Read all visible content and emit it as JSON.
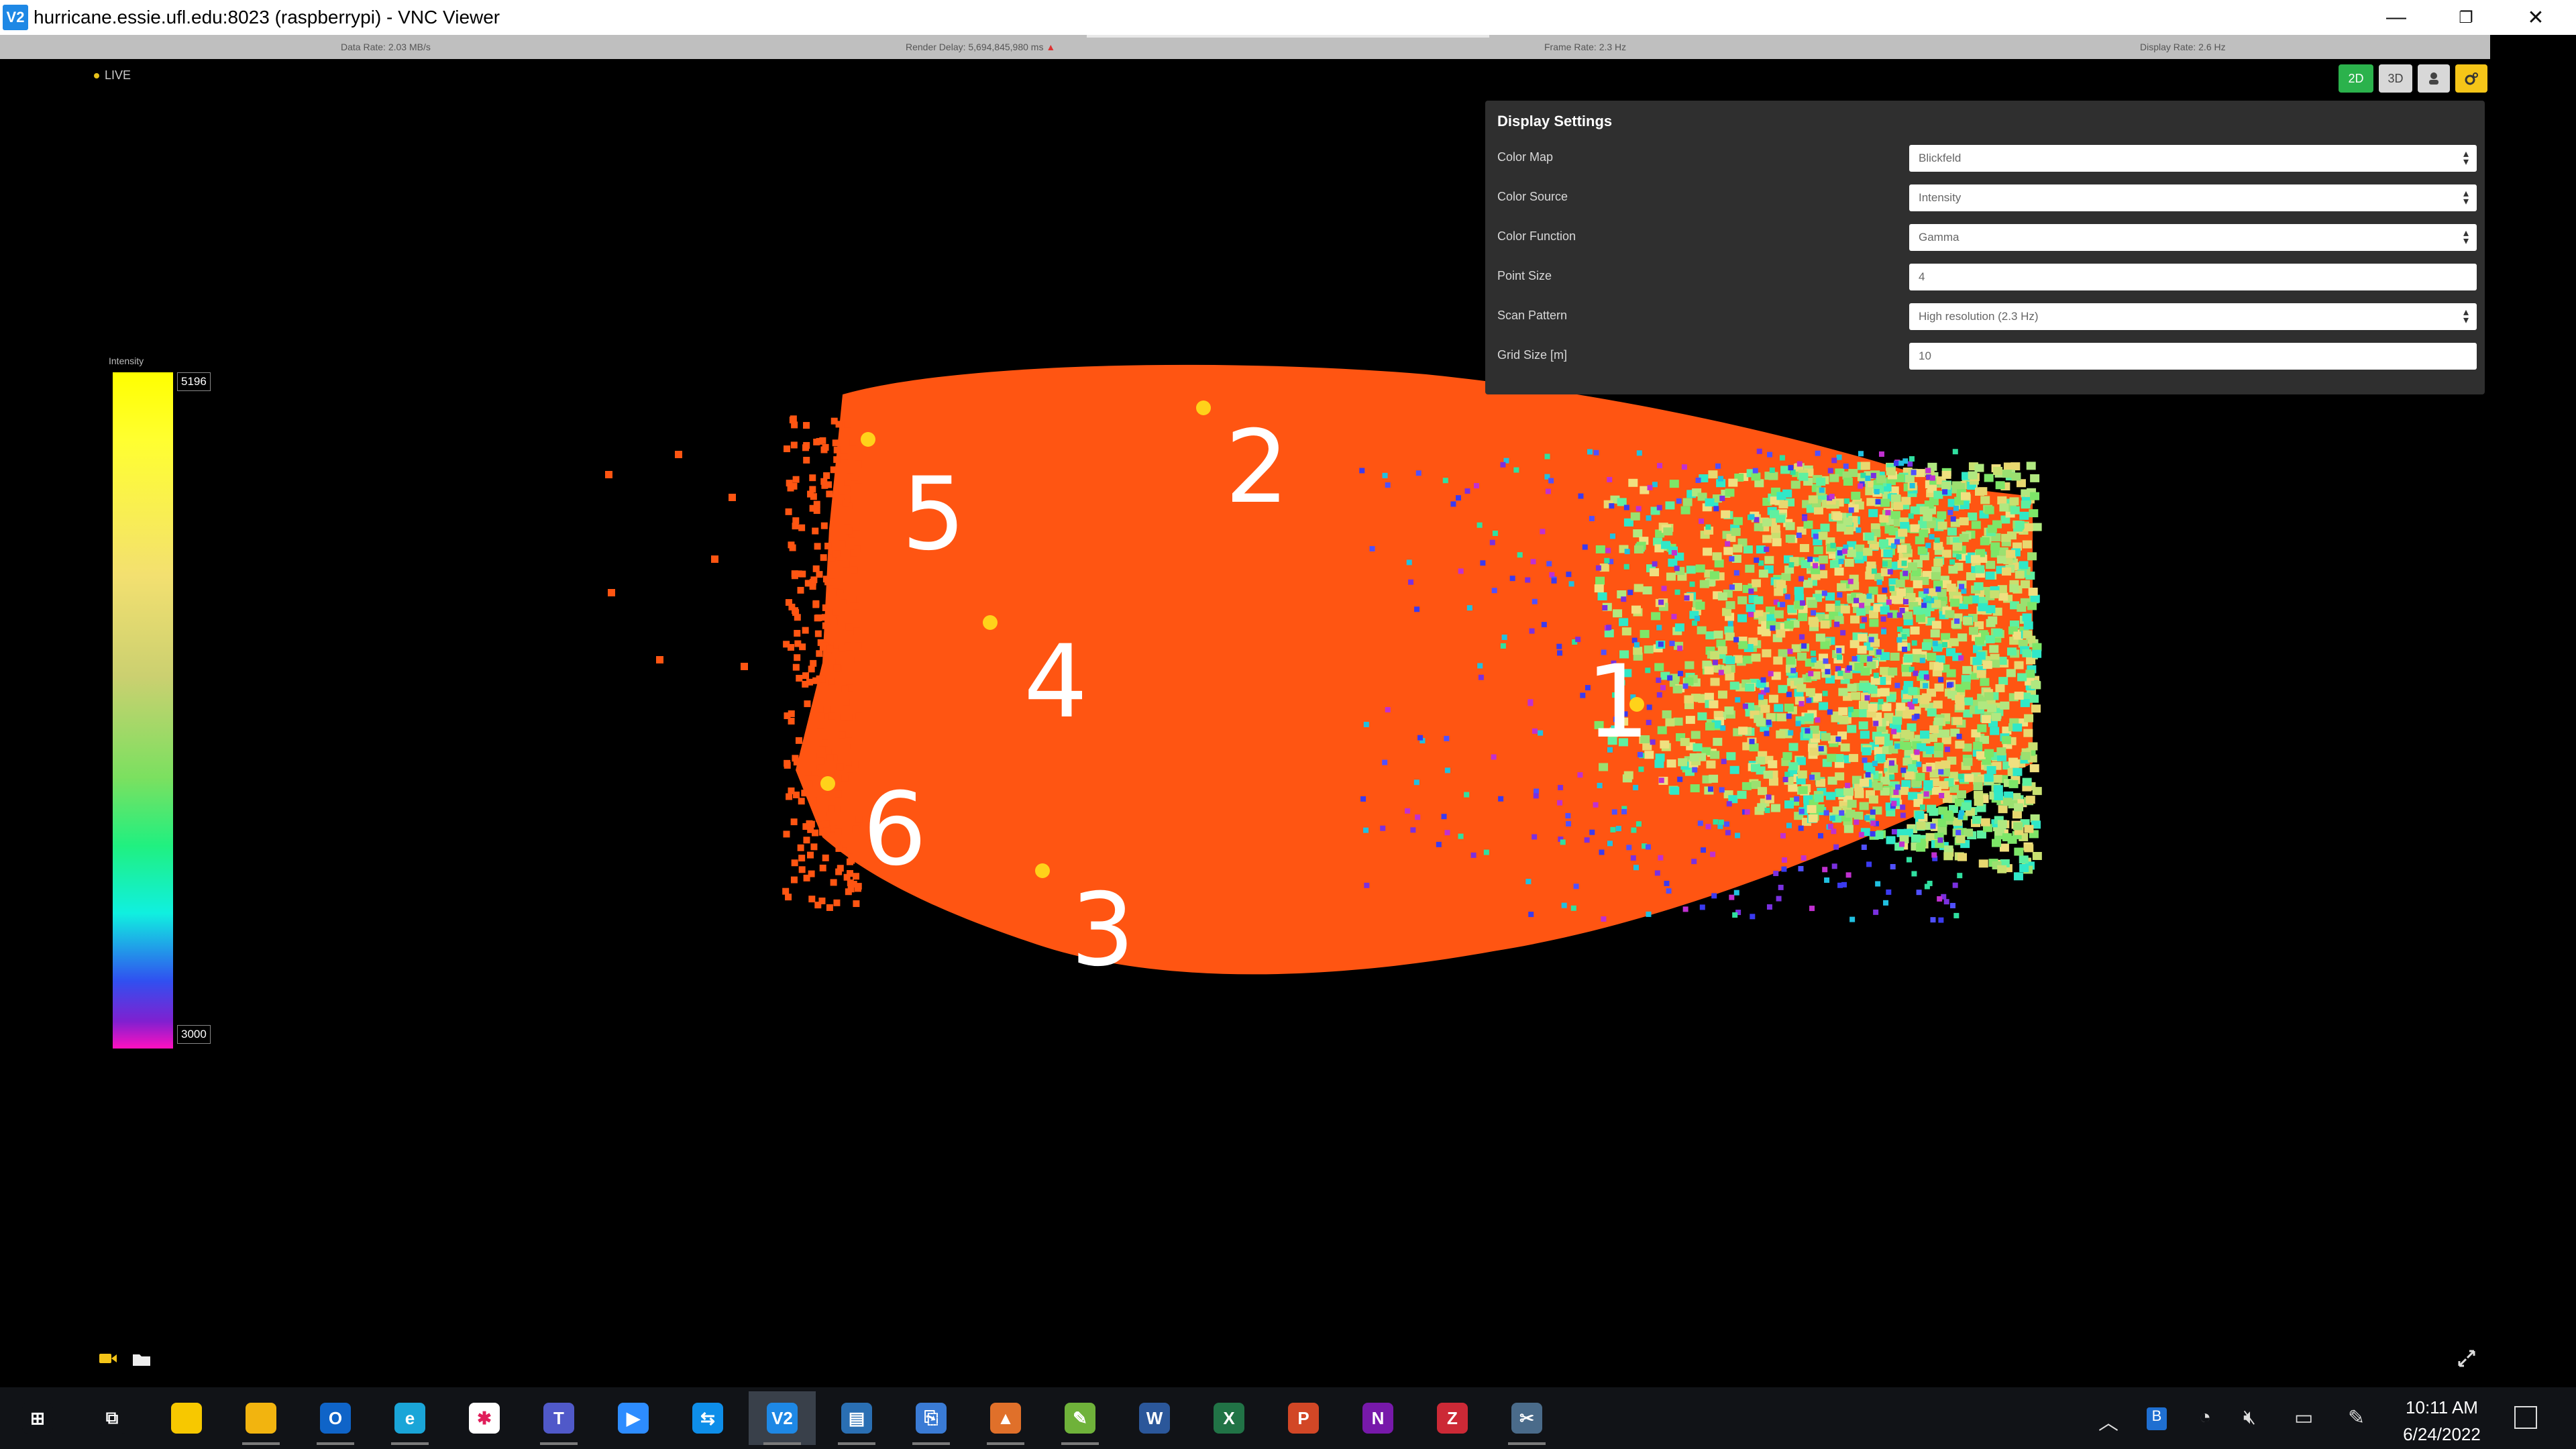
{
  "window": {
    "icon_label": "V2",
    "title": "hurricane.essie.ufl.edu:8023 (raspberrypi) - VNC Viewer",
    "minimize": "—",
    "restore": "❐",
    "close": "✕"
  },
  "stats": {
    "data_rate": "Data Rate: 2.03 MB/s",
    "render_delay": "Render Delay: 5,694,845,980 ms",
    "frame_rate": "Frame Rate: 2.3 Hz",
    "display_rate": "Display Rate: 2.6 Hz"
  },
  "viewer": {
    "live_label": "LIVE",
    "mode_buttons": [
      {
        "label": "2D",
        "active": true
      },
      {
        "label": "3D",
        "active": false
      },
      {
        "label": "",
        "icon": "person-icon"
      },
      {
        "label": "",
        "icon": "settings-gear-icon"
      }
    ]
  },
  "display_settings": {
    "title": "Display Settings",
    "rows": [
      {
        "label": "Color Map",
        "value": "Blickfeld",
        "type": "select"
      },
      {
        "label": "Color Source",
        "value": "Intensity",
        "type": "select"
      },
      {
        "label": "Color Function",
        "value": "Gamma",
        "type": "select"
      },
      {
        "label": "Point Size",
        "value": "4",
        "type": "input"
      },
      {
        "label": "Scan Pattern",
        "value": "High resolution (2.3 Hz)",
        "type": "select"
      },
      {
        "label": "Grid Size [m]",
        "value": "10",
        "type": "input"
      }
    ]
  },
  "colorbar": {
    "title": "Intensity",
    "max": "5196",
    "min": "3000"
  },
  "annotations": [
    "1",
    "2",
    "3",
    "4",
    "5",
    "6"
  ],
  "colors": {
    "cloud_orange": "#ff5512",
    "accent_green": "#2bb24c",
    "accent_yellow": "#f5c518",
    "panel_bg": "#2f2f2f"
  },
  "taskbar": {
    "apps": [
      {
        "name": "start",
        "glyph": "⊞",
        "color": "#111317"
      },
      {
        "name": "task-view",
        "glyph": "⧉",
        "color": "#111317"
      },
      {
        "name": "sticky-notes",
        "glyph": "",
        "color": "#f7c800"
      },
      {
        "name": "file-explorer",
        "glyph": "",
        "color": "#f2b40f"
      },
      {
        "name": "outlook",
        "glyph": "O",
        "color": "#0f64c8"
      },
      {
        "name": "edge",
        "glyph": "e",
        "color": "#1aa5d8"
      },
      {
        "name": "slack",
        "glyph": "✱",
        "color": "#ffffff"
      },
      {
        "name": "teams",
        "glyph": "T",
        "color": "#5059c9"
      },
      {
        "name": "zoom",
        "glyph": "▶",
        "color": "#2d8cff"
      },
      {
        "name": "teamviewer",
        "glyph": "⇆",
        "color": "#0e8ee9"
      },
      {
        "name": "vnc-viewer",
        "glyph": "V2",
        "color": "#1e88e5"
      },
      {
        "name": "clipboard",
        "glyph": "▤",
        "color": "#2a6fb3"
      },
      {
        "name": "network",
        "glyph": "⎘",
        "color": "#3a7bd5"
      },
      {
        "name": "matlab",
        "glyph": "▲",
        "color": "#e0702a"
      },
      {
        "name": "image-editor",
        "glyph": "✎",
        "color": "#6fb23a"
      },
      {
        "name": "word",
        "glyph": "W",
        "color": "#2b579a"
      },
      {
        "name": "excel",
        "glyph": "X",
        "color": "#217346"
      },
      {
        "name": "powerpoint",
        "glyph": "P",
        "color": "#d24726"
      },
      {
        "name": "onenote",
        "glyph": "N",
        "color": "#7719aa"
      },
      {
        "name": "zotero",
        "glyph": "Z",
        "color": "#cc2936"
      },
      {
        "name": "snipping",
        "glyph": "✂",
        "color": "#4a6b8a"
      }
    ],
    "time": "10:11 AM",
    "date": "6/24/2022"
  }
}
